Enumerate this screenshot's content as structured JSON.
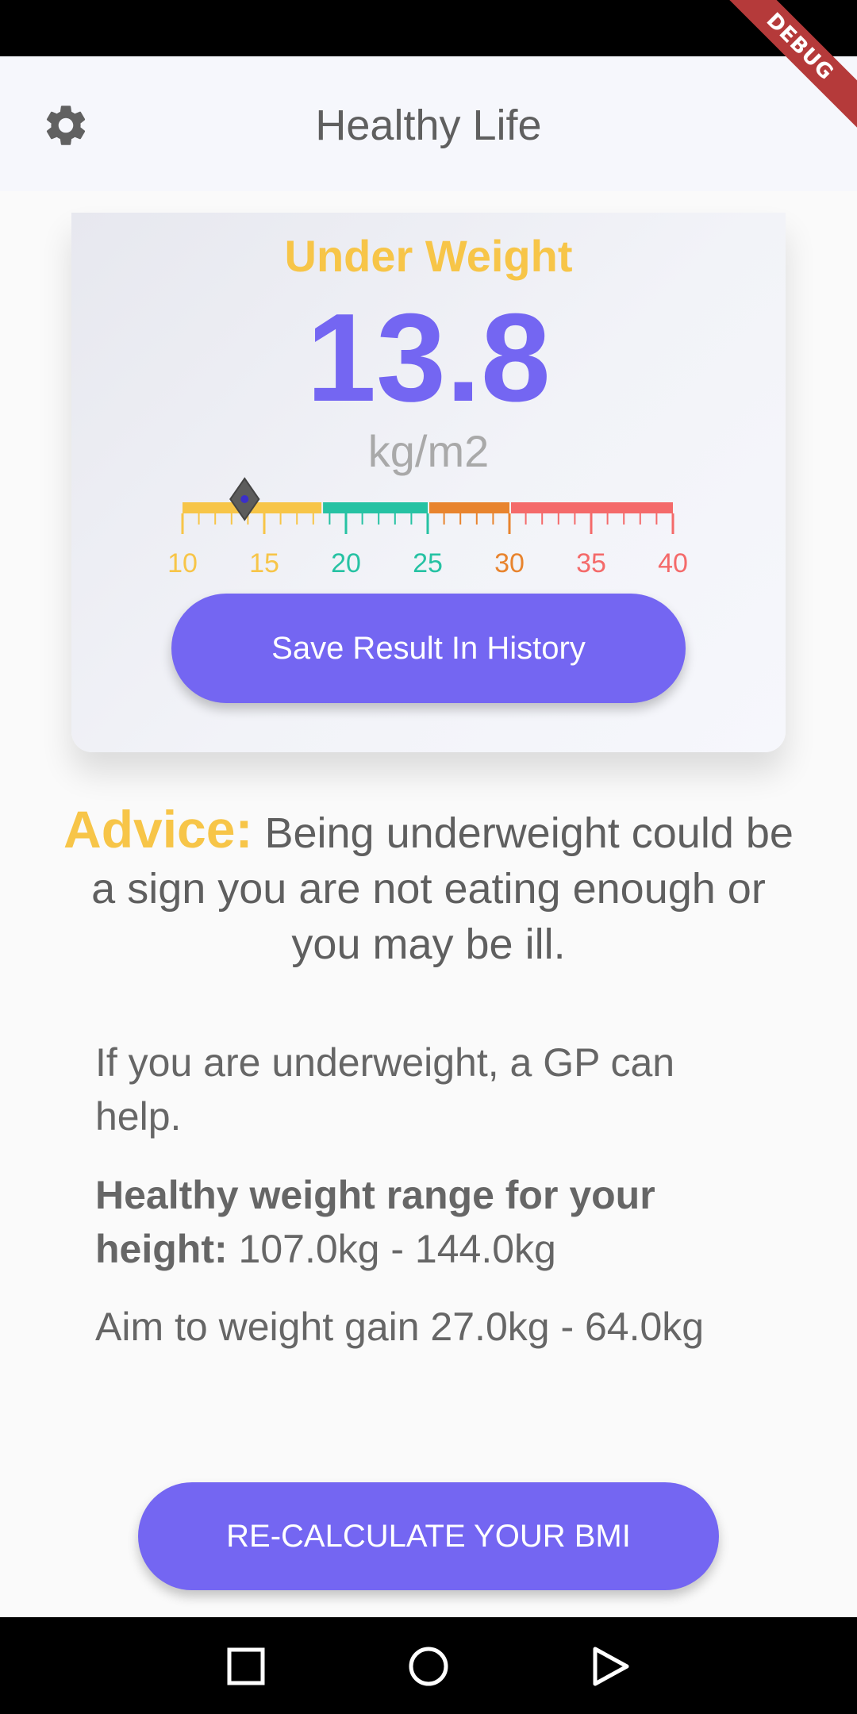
{
  "debug_banner": "DEBUG",
  "app_bar": {
    "title": "Healthy Life",
    "settings_icon": "gear-icon"
  },
  "result": {
    "category": "Under Weight",
    "bmi": "13.8",
    "unit": "kg/m2",
    "marker_value": 13.8,
    "save_button": "Save Result In History"
  },
  "scale": {
    "min": 10,
    "max": 40,
    "ticks": [
      "10",
      "15",
      "20",
      "25",
      "30",
      "35",
      "40"
    ],
    "segments": [
      {
        "from": 10,
        "to": 18.5,
        "color": "#f7c548"
      },
      {
        "from": 18.5,
        "to": 25,
        "color": "#26c2a3"
      },
      {
        "from": 25,
        "to": 30,
        "color": "#e8842e"
      },
      {
        "from": 30,
        "to": 40,
        "color": "#f46a6a"
      }
    ]
  },
  "advice": {
    "label": "Advice:",
    "text": " Being underweight could be a sign you are not eating enough or you may be ill."
  },
  "info": {
    "gp_text": "If you are underweight, a GP can help.",
    "range_label": "Healthy weight range for your height:",
    "range_value": " 107.0kg - 144.0kg",
    "aim_text": "Aim to weight gain 27.0kg - 64.0kg"
  },
  "recalculate_button": "RE-CALCULATE YOUR BMI",
  "nav": {
    "recents_icon": "square-icon",
    "home_icon": "circle-icon",
    "back_icon": "triangle-back-icon"
  },
  "colors": {
    "accent": "#7466f2",
    "underweight": "#f7c548",
    "normal": "#26c2a3",
    "overweight": "#e8842e",
    "obese": "#f46a6a"
  }
}
